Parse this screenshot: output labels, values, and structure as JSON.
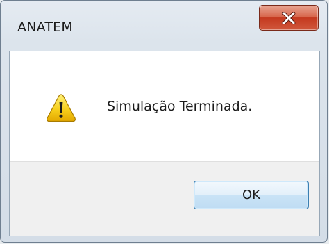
{
  "window": {
    "title": "ANATEM"
  },
  "titlebar": {
    "close_icon": "close-icon"
  },
  "dialog": {
    "icon": "warning-icon",
    "message": "Simulação Terminada.",
    "ok_label": "OK"
  },
  "colors": {
    "close_button_red": "#c4391f",
    "ok_button_border": "#3c7fb1",
    "warning_yellow": "#f5c400"
  }
}
